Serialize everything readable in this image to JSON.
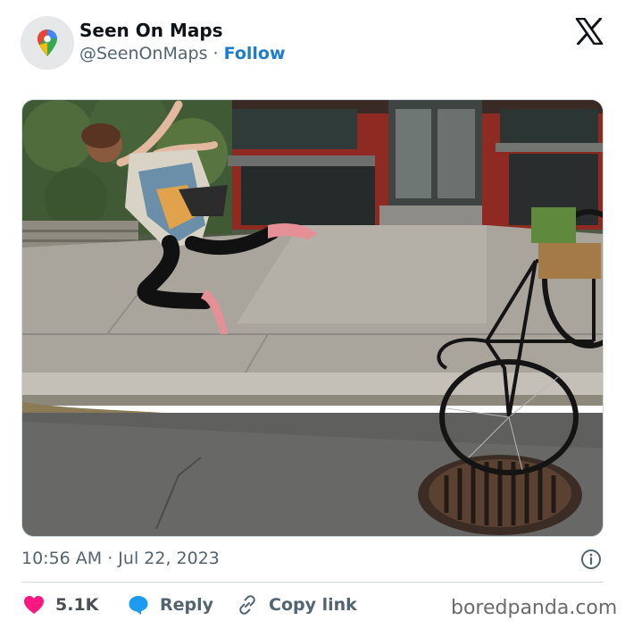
{
  "header": {
    "display_name": "Seen On Maps",
    "handle": "@SeenOnMaps",
    "separator": "·",
    "follow_label": "Follow",
    "avatar_icon": "maps-pin-icon",
    "platform_icon": "x-logo-icon"
  },
  "media": {
    "icon": "photo"
  },
  "meta": {
    "timestamp": "10:56 AM · Jul 22, 2023",
    "info_icon": "info-icon"
  },
  "actions": {
    "like_count": "5.1K",
    "reply_label": "Reply",
    "copy_label": "Copy link"
  },
  "watermark": "boredpanda.com",
  "colors": {
    "accent": "#1d7bd0",
    "like": "#f91880",
    "reply_icon": "#1d9bf0",
    "text_secondary": "#536471"
  }
}
